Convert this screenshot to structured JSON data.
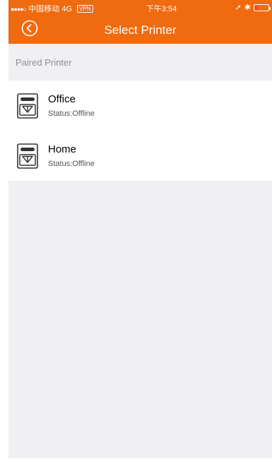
{
  "status_bar": {
    "signal": "●●●●○",
    "carrier": "中国移动",
    "network": "4G",
    "vpn": "VPN",
    "time": "下午3:54",
    "location_glyph": "➚",
    "bluetooth_glyph": "✱"
  },
  "nav": {
    "title": "Select Printer",
    "back_icon": "chevron-left-circle-icon"
  },
  "section": {
    "label": "Paired Printer"
  },
  "printers": [
    {
      "name": "Office",
      "status": "Status:Offline",
      "icon": "printer-icon"
    },
    {
      "name": "Home",
      "status": "Status:Offline",
      "icon": "printer-icon"
    }
  ],
  "colors": {
    "accent": "#f06a0f",
    "background": "#efeff4",
    "list_background": "#ffffff",
    "battery_low": "#ff3b30"
  }
}
